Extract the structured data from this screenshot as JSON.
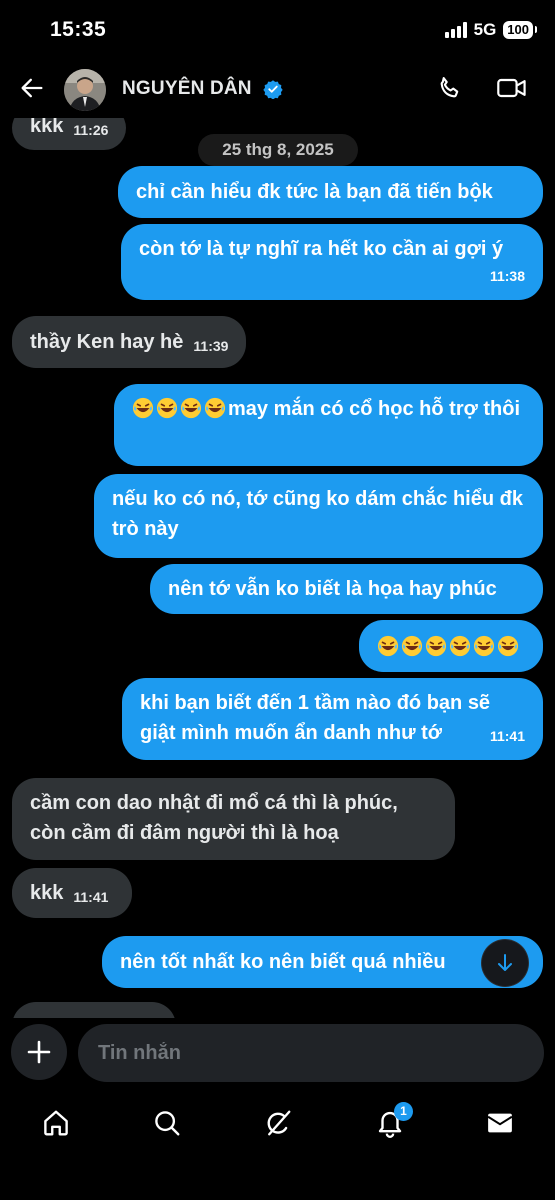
{
  "status": {
    "time": "15:35",
    "network": "5G",
    "battery": "100"
  },
  "header": {
    "contact_name": "NGUYÊN DÂN"
  },
  "date_separator": "25 thg 8, 2025",
  "messages": [
    {
      "side": "in",
      "text": "kkk",
      "time": "11:26"
    },
    {
      "side": "out",
      "text": "chỉ cần hiểu đk tức là bạn đã tiến bộk",
      "time": ""
    },
    {
      "side": "out",
      "text": "còn tớ là tự nghĩ ra hết ko cần ai gợi ý",
      "time": "11:38"
    },
    {
      "side": "in",
      "text": "thầy Ken hay hè",
      "time": "11:39"
    },
    {
      "side": "out",
      "text": "may mắn có cổ học hỗ trợ thôi",
      "time": ""
    },
    {
      "side": "out",
      "text": "nếu ko có nó, tớ cũng ko dám chắc hiểu đk trò này",
      "time": ""
    },
    {
      "side": "out",
      "text": "nên tớ vẫn ko biết là họa hay phúc",
      "time": ""
    },
    {
      "side": "out",
      "text": "",
      "time": ""
    },
    {
      "side": "out",
      "text": "khi bạn biết đến 1 tầm nào đó bạn sẽ giật mình muốn ẩn danh như tớ",
      "time": "11:41"
    },
    {
      "side": "in",
      "text": "cầm con dao nhật đi mổ cá thì là phúc, còn cầm đi đâm người thì là hoạ",
      "time": ""
    },
    {
      "side": "in",
      "text": "kkk",
      "time": "11:41"
    },
    {
      "side": "out",
      "text": "nên tốt nhất ko nên biết quá nhiều",
      "time": ""
    }
  ],
  "composer": {
    "placeholder": "Tin nhắn"
  },
  "nav": {
    "notifications_badge": "1"
  },
  "colors": {
    "outgoing": "#1d9bf0",
    "incoming": "#2f3336",
    "background": "#000000"
  },
  "icons": [
    "back-arrow-icon",
    "verified-icon",
    "phone-icon",
    "video-icon",
    "plus-icon",
    "home-icon",
    "search-icon",
    "grok-icon",
    "bell-icon",
    "mail-icon",
    "arrow-down-icon",
    "laughing-emoji-icon"
  ]
}
